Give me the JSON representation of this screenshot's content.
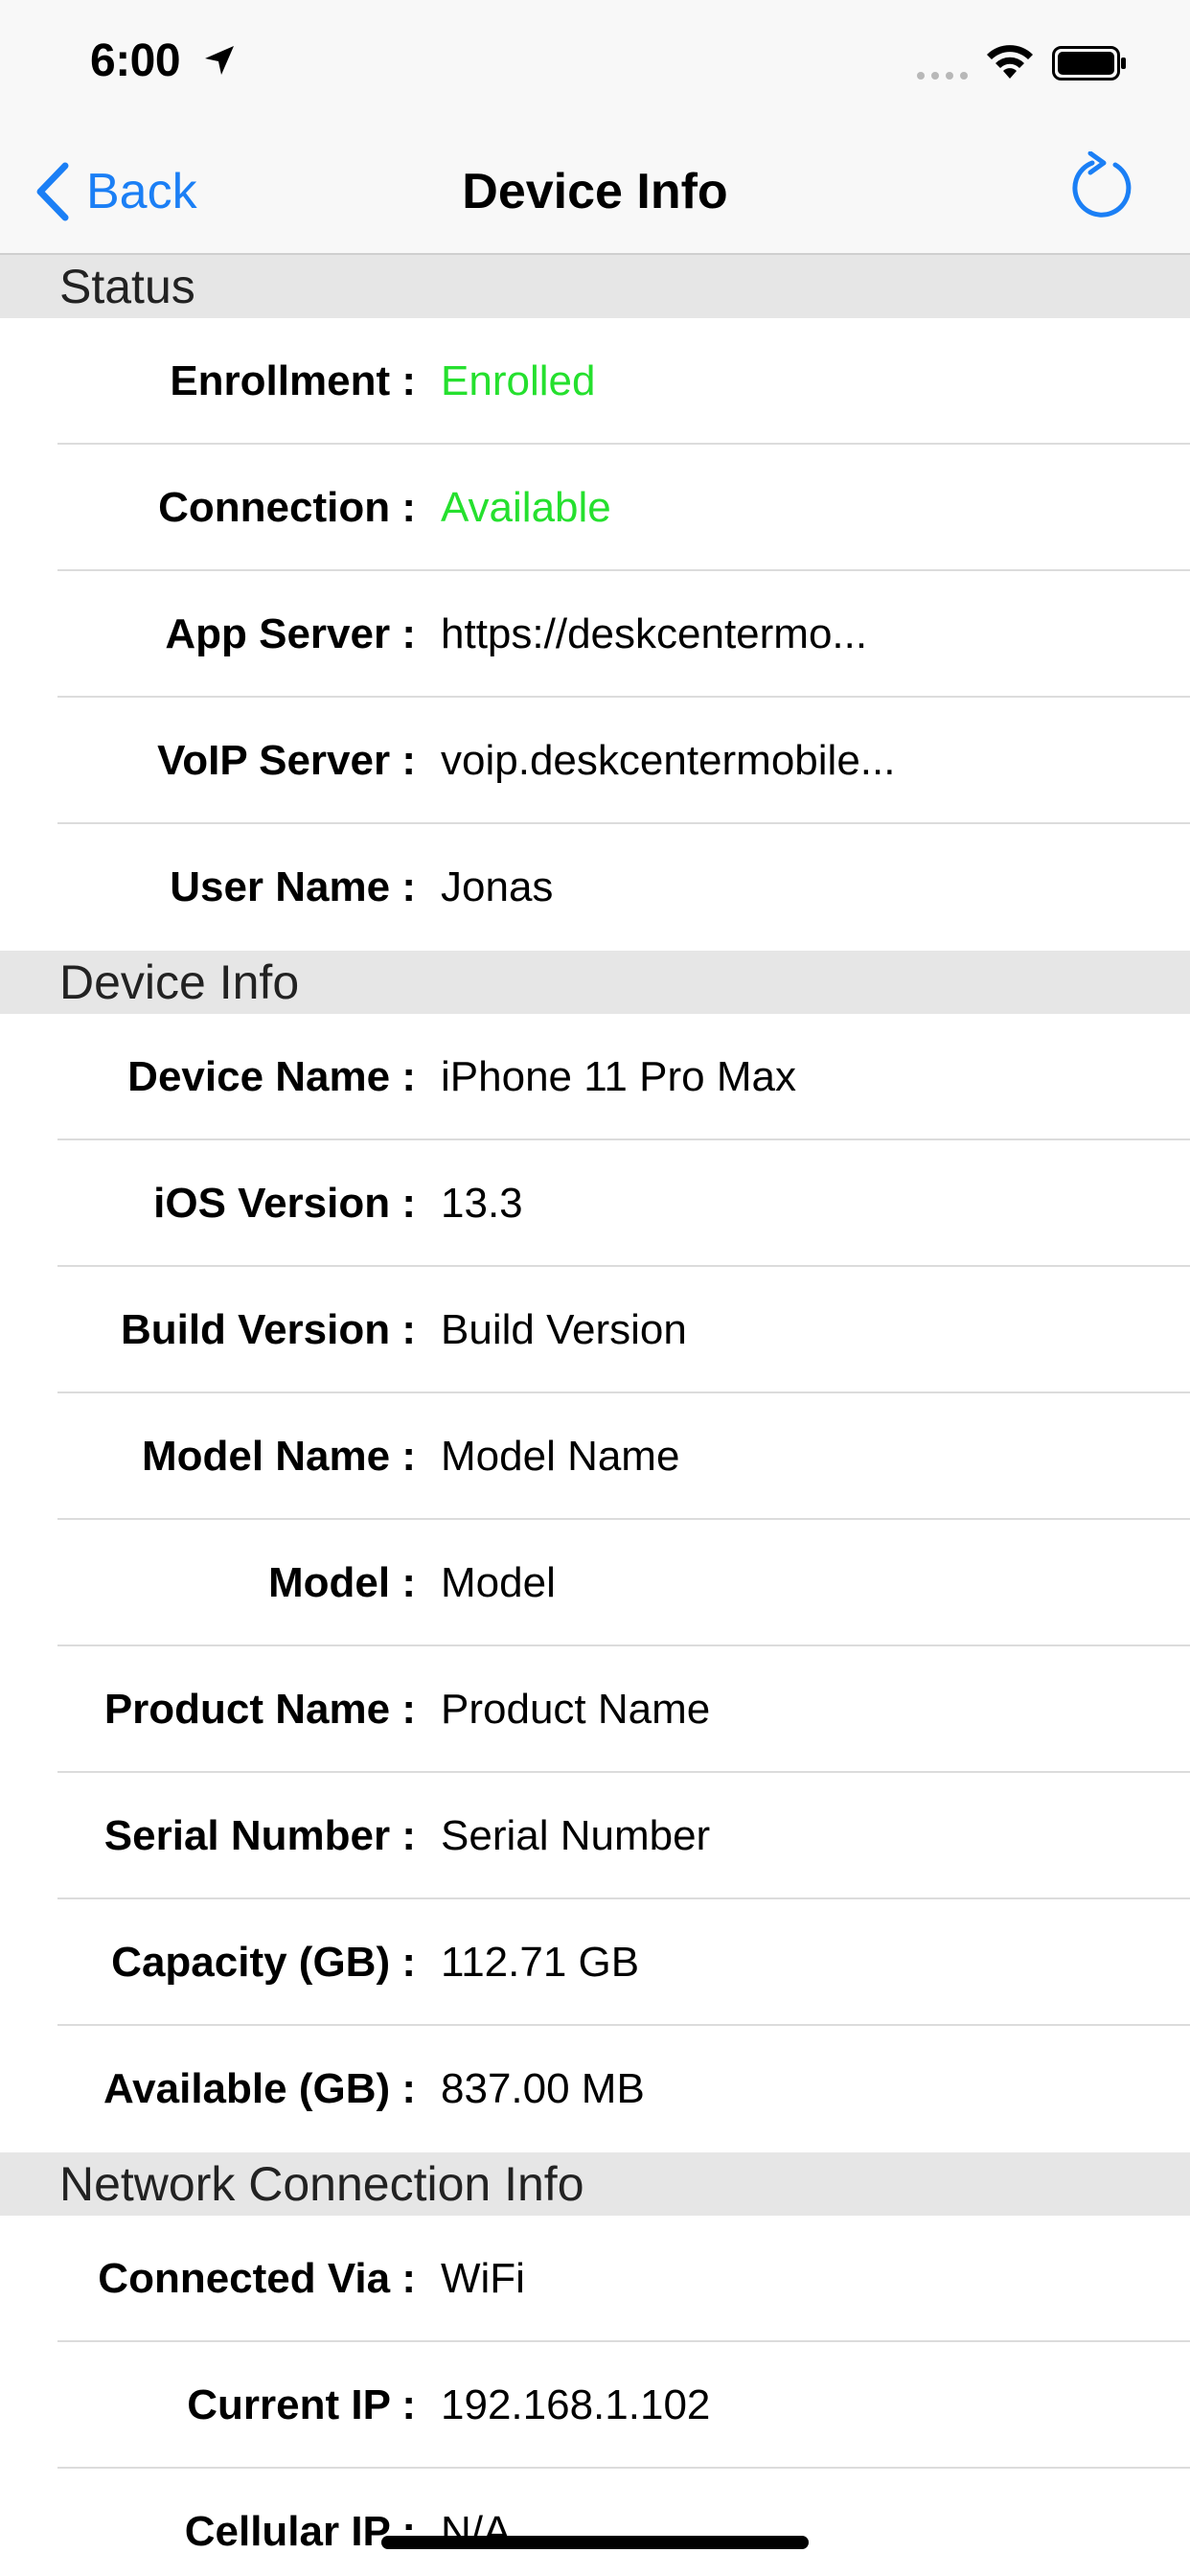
{
  "status_bar": {
    "time": "6:00",
    "icons": [
      "location-arrow-icon",
      "cellular-signal-icon",
      "wifi-icon",
      "battery-icon"
    ]
  },
  "nav": {
    "back_label": "Back",
    "title": "Device Info",
    "refresh_icon": "refresh-icon"
  },
  "colors": {
    "accent": "#1b7ff5",
    "status_green": "#25e02e",
    "section_bg": "#e6e6e6"
  },
  "sections": {
    "status": {
      "title": "Status",
      "rows": [
        {
          "label": "Enrollment :",
          "value": "Enrolled"
        },
        {
          "label": "Connection :",
          "value": "Available"
        },
        {
          "label": "App Server :",
          "value": "https://deskcentermo..."
        },
        {
          "label": "VoIP Server :",
          "value": "voip.deskcentermobile..."
        },
        {
          "label": "User Name :",
          "value": "Jonas"
        }
      ]
    },
    "device_info": {
      "title": "Device Info",
      "rows": [
        {
          "label": "Device Name :",
          "value": "iPhone 11 Pro Max"
        },
        {
          "label": "iOS Version :",
          "value": "13.3"
        },
        {
          "label": "Build Version :",
          "value": "Build Version"
        },
        {
          "label": "Model Name :",
          "value": "Model Name"
        },
        {
          "label": "Model :",
          "value": "Model"
        },
        {
          "label": "Product Name :",
          "value": "Product Name"
        },
        {
          "label": "Serial Number :",
          "value": "Serial Number"
        },
        {
          "label": "Capacity (GB) :",
          "value": "112.71 GB"
        },
        {
          "label": "Available (GB) :",
          "value": "837.00 MB"
        }
      ]
    },
    "network": {
      "title": "Network Connection Info",
      "rows": [
        {
          "label": "Connected Via :",
          "value": "WiFi"
        },
        {
          "label": "Current IP :",
          "value": "192.168.1.102"
        },
        {
          "label": "Cellular IP :",
          "value": "N/A"
        }
      ]
    }
  }
}
